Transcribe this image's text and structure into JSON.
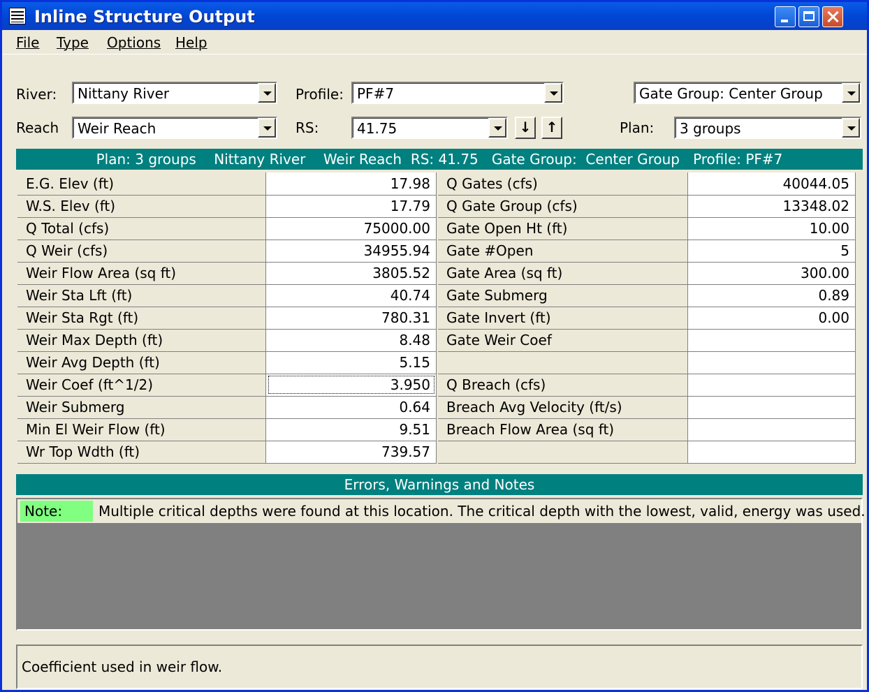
{
  "window": {
    "title": "Inline Structure Output"
  },
  "menu": [
    "File",
    "Type",
    "Options",
    "Help"
  ],
  "selectors": {
    "river_label": "River:",
    "river": "Nittany River",
    "reach_label": "Reach",
    "reach": "Weir Reach",
    "profile_label": "Profile:",
    "profile": "PF#7",
    "rs_label": "RS:",
    "rs": "41.75",
    "gate_group": "Gate Group:  Center Group",
    "plan_label": "Plan:",
    "plan": "3 groups"
  },
  "header_band": "Plan: 3 groups    Nittany River    Weir Reach  RS: 41.75   Gate Group:  Center Group   Profile: PF#7",
  "left_table": [
    {
      "name": "E.G. Elev (ft)",
      "value": "17.98"
    },
    {
      "name": "W.S. Elev (ft)",
      "value": "17.79"
    },
    {
      "name": "Q Total (cfs)",
      "value": "75000.00"
    },
    {
      "name": "Q Weir (cfs)",
      "value": "34955.94"
    },
    {
      "name": "Weir Flow Area (sq ft)",
      "value": "3805.52"
    },
    {
      "name": "Weir Sta Lft (ft)",
      "value": "40.74"
    },
    {
      "name": "Weir Sta Rgt (ft)",
      "value": "780.31"
    },
    {
      "name": "Weir Max Depth (ft)",
      "value": "8.48"
    },
    {
      "name": "Weir Avg Depth (ft)",
      "value": "5.15"
    },
    {
      "name": "Weir Coef (ft^1/2)",
      "value": "3.950"
    },
    {
      "name": "Weir Submerg",
      "value": "0.64"
    },
    {
      "name": "Min El Weir Flow (ft)",
      "value": "9.51"
    },
    {
      "name": "Wr Top Wdth (ft)",
      "value": "739.57"
    }
  ],
  "right_table": [
    {
      "name": "Q Gates (cfs)",
      "value": "40044.05"
    },
    {
      "name": "Q Gate Group (cfs)",
      "value": "13348.02"
    },
    {
      "name": "Gate Open Ht (ft)",
      "value": "10.00"
    },
    {
      "name": "Gate #Open",
      "value": "5"
    },
    {
      "name": "Gate Area (sq ft)",
      "value": "300.00"
    },
    {
      "name": "Gate Submerg",
      "value": "0.89"
    },
    {
      "name": "Gate Invert (ft)",
      "value": "0.00"
    },
    {
      "name": "Gate Weir Coef",
      "value": ""
    },
    {
      "name": "",
      "value": ""
    },
    {
      "name": "Q Breach (cfs)",
      "value": ""
    },
    {
      "name": "Breach Avg Velocity (ft/s)",
      "value": ""
    },
    {
      "name": "Breach Flow Area (sq ft)",
      "value": ""
    },
    {
      "name": "",
      "value": ""
    }
  ],
  "notes_band": "Errors, Warnings and Notes",
  "notes": [
    {
      "tag": "Note:",
      "text": "Multiple critical depths were found at this location.  The critical depth with the lowest, valid, energy was used."
    }
  ],
  "status_text": "Coefficient used in weir flow.",
  "colors": {
    "band": "#00807f",
    "note_tag": "#80ff80"
  },
  "icons": [
    "table-icon",
    "arrow-down-icon",
    "arrow-up-icon"
  ]
}
